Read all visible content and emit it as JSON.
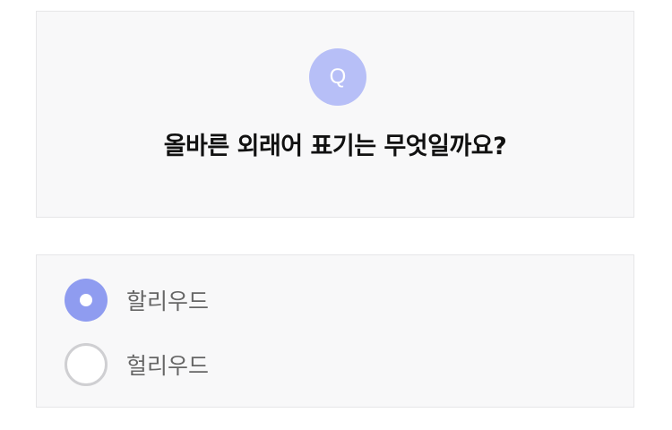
{
  "question": {
    "badge": "Q",
    "text": "올바른 외래어 표기는 무엇일까요?"
  },
  "options": [
    {
      "label": "할리우드",
      "selected": true
    },
    {
      "label": "헐리우드",
      "selected": false
    }
  ],
  "colors": {
    "accent": "#8f9cf0",
    "badge": "#b7bff7",
    "card_background": "#f8f8f9",
    "card_border": "#e6e6e8",
    "unselected_ring": "#cfcfd2"
  }
}
